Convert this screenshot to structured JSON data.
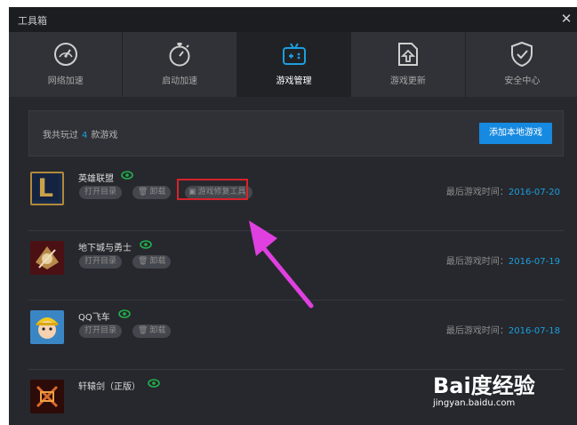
{
  "window": {
    "title": "工具箱",
    "close_icon": "✕"
  },
  "tabs": [
    {
      "label": "网络加速",
      "icon": "speedometer-icon",
      "active": false
    },
    {
      "label": "启动加速",
      "icon": "stopwatch-icon",
      "active": false
    },
    {
      "label": "游戏管理",
      "icon": "gamepad-icon",
      "active": true
    },
    {
      "label": "游戏更新",
      "icon": "upload-icon",
      "active": false
    },
    {
      "label": "安全中心",
      "icon": "shield-check-icon",
      "active": false
    }
  ],
  "summary": {
    "prefix": "我共玩过",
    "count": "4",
    "suffix": "款游戏",
    "add_button": "添加本地游戏"
  },
  "games": [
    {
      "name": "英雄联盟",
      "open_dir": "打开目录",
      "uninstall": "卸载",
      "repair_tool": "游戏修复工具",
      "last_played_label": "最后游戏时间：",
      "last_played_date": "2016-07-20"
    },
    {
      "name": "地下城与勇士",
      "open_dir": "打开目录",
      "uninstall": "卸载",
      "last_played_label": "最后游戏时间：",
      "last_played_date": "2016-07-19"
    },
    {
      "name": "QQ飞车",
      "open_dir": "打开目录",
      "uninstall": "卸载",
      "last_played_label": "最后游戏时间：",
      "last_played_date": "2016-07-18"
    },
    {
      "name": "轩辕剑（正版）"
    }
  ],
  "colors": {
    "accent": "#1c9fe0",
    "button": "#1689e0",
    "highlight": "#d8232a",
    "arrow": "#e040e0",
    "eye": "#22b14c"
  },
  "watermark": {
    "brand": "Bai度经验",
    "url": "jingyan.baidu.com"
  }
}
